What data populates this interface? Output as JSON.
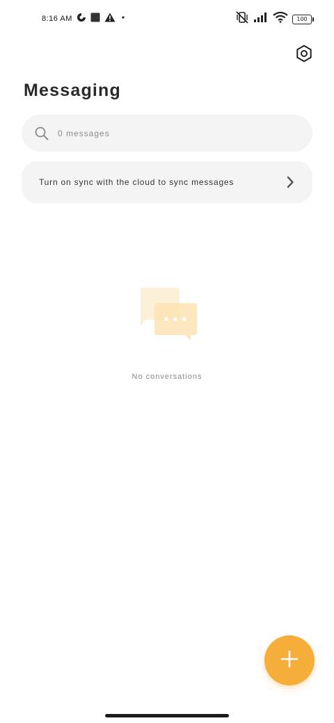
{
  "status_bar": {
    "time": "8:16 AM",
    "battery_level": "100",
    "icons": [
      "data-saver-icon",
      "stop-square-icon",
      "alert-triangle-icon",
      "dot-icon",
      "vibrate-off-icon",
      "signal-icon",
      "wifi-icon",
      "battery-icon"
    ]
  },
  "header": {
    "title": "Messaging",
    "settings_icon": "settings-hexagon-icon"
  },
  "search": {
    "placeholder": "0 messages",
    "icon": "search-icon"
  },
  "sync_banner": {
    "label": "Turn on sync with the cloud to sync messages",
    "icon": "chevron-right-icon"
  },
  "empty_state": {
    "message": "No conversations",
    "icon": "chat-bubbles-icon"
  },
  "fab": {
    "icon": "plus-icon",
    "color": "#f6ad3a"
  },
  "colors": {
    "accent": "#f6ad3a",
    "surface": "#f4f4f4",
    "illustration_light": "#fdf0d8",
    "illustration_mid": "#fde3b4"
  }
}
